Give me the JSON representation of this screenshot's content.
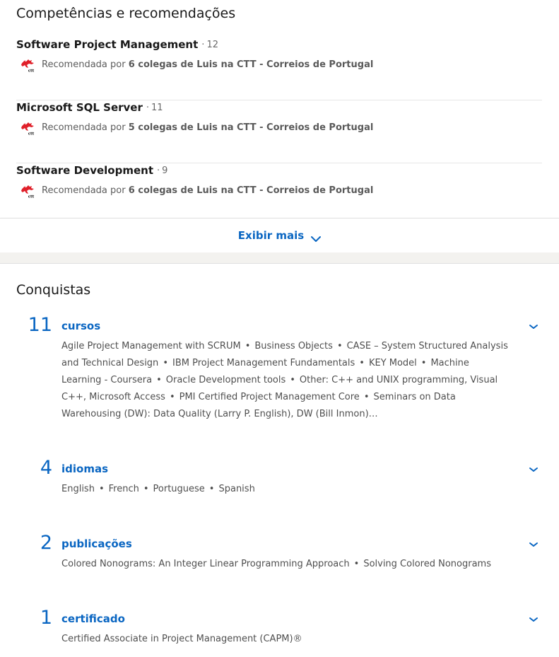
{
  "skills": {
    "title": "Competências e recomendações",
    "separator": "·",
    "endorsed_by_prefix": "Recomendada por",
    "items": [
      {
        "name": "Software Project Management",
        "count": "12",
        "endorsers": "6 colegas de Luis na CTT - Correios de Portugal",
        "logo": "ctt-logo-icon"
      },
      {
        "name": "Microsoft SQL Server",
        "count": "11",
        "endorsers": "5 colegas de Luis na CTT - Correios de Portugal",
        "logo": "ctt-logo-icon"
      },
      {
        "name": "Software Development",
        "count": "9",
        "endorsers": "6 colegas de Luis na CTT - Correios de Portugal",
        "logo": "ctt-logo-icon"
      }
    ],
    "show_more": "Exibir mais"
  },
  "accomplishments": {
    "title": "Conquistas",
    "groups": [
      {
        "count": "11",
        "title": "cursos",
        "items": [
          "Agile Project Management with SCRUM",
          "Business Objects",
          "CASE – System Structured Analysis and Technical Design",
          "IBM Project Management Fundamentals",
          "KEY Model",
          "Machine Learning - Coursera",
          "Oracle Development tools",
          "Other: C++ and UNIX programming, Visual C++, Microsoft Access",
          "PMI Certified Project Management Core",
          "Seminars on Data Warehousing (DW): Data Quality (Larry P. English), DW (Bill Inmon)…"
        ]
      },
      {
        "count": "4",
        "title": "idiomas",
        "items": [
          "English",
          "French",
          "Portuguese",
          "Spanish"
        ]
      },
      {
        "count": "2",
        "title": "publicações",
        "items": [
          "Colored Nonograms: An Integer Linear Programming Approach",
          "Solving Colored Nonograms"
        ]
      },
      {
        "count": "1",
        "title": "certificado",
        "items": [
          "Certified Associate in Project Management (CAPM)®"
        ]
      }
    ]
  },
  "colors": {
    "link_blue": "#0a66c2",
    "page_band": "#f3f2ef",
    "logo_red": "#e0202a"
  },
  "icons": {
    "chevron": "chevron-down-icon",
    "logo": "ctt-logo-icon"
  }
}
